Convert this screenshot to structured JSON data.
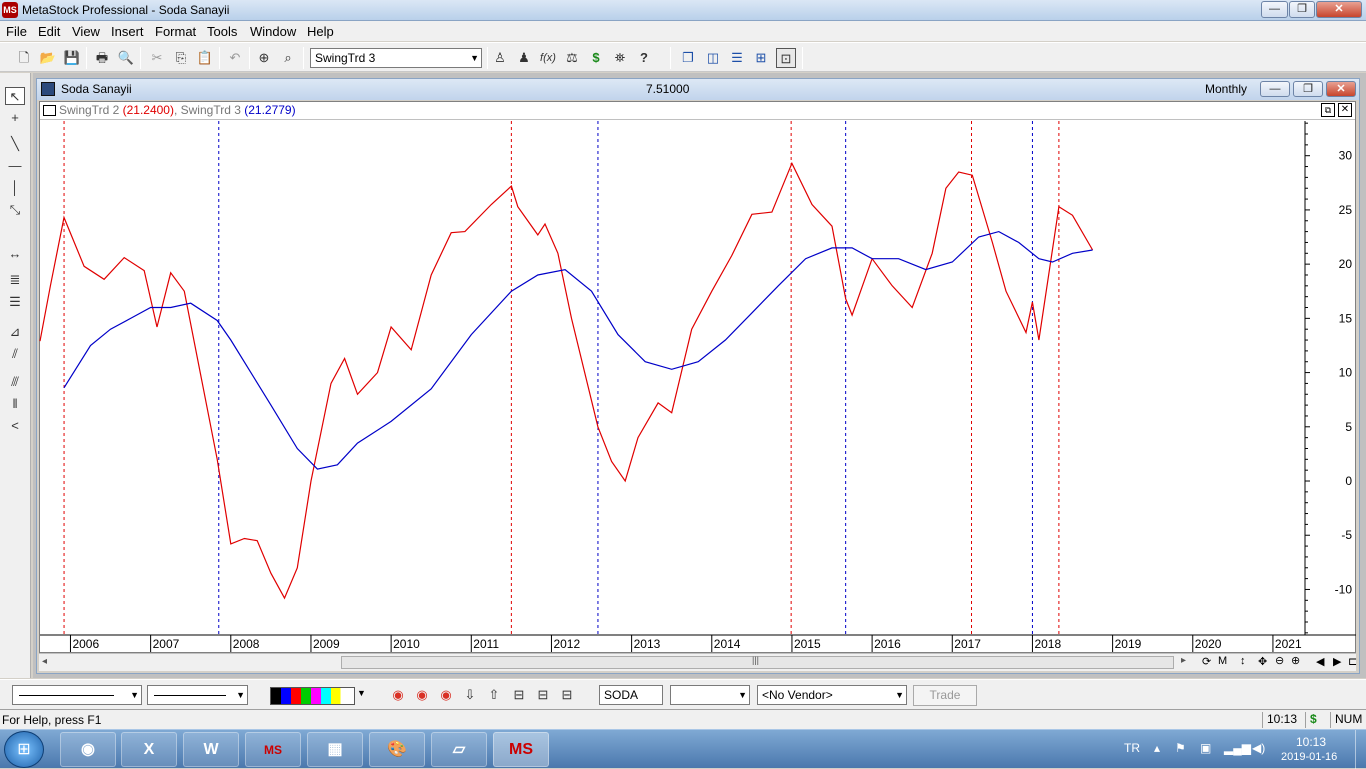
{
  "window": {
    "title": "MetaStock Professional - Soda Sanayii",
    "minimize": "—",
    "maximize": "❐",
    "close": "✕"
  },
  "menu": [
    "File",
    "Edit",
    "View",
    "Insert",
    "Format",
    "Tools",
    "Window",
    "Help"
  ],
  "toolbar": {
    "template_combo": "SwingTrd 3",
    "dollar": "$",
    "fx": "f(x)"
  },
  "chart_window": {
    "title": "Soda Sanayii",
    "price": "7.51000",
    "periodicity": "Monthly"
  },
  "legend": {
    "s1_name": "SwingTrd 2",
    "s1_value": "(21.2400)",
    "s2_name": "SwingTrd 3",
    "s2_value": "(21.2779)",
    "sep": ", "
  },
  "chart_data": {
    "type": "line",
    "x_range": [
      2005.62,
      2021.4
    ],
    "y_range": [
      -14.2,
      33.2
    ],
    "x_ticks": [
      2006,
      2007,
      2008,
      2009,
      2010,
      2011,
      2012,
      2013,
      2014,
      2015,
      2016,
      2017,
      2018,
      2019,
      2020,
      2021
    ],
    "x_tick_labels": [
      "2006",
      "2007",
      "2008",
      "2009",
      "2010",
      "2011",
      "2012",
      "2013",
      "2014",
      "2015",
      "2016",
      "2017",
      "2018",
      "2019",
      "2020",
      "2021"
    ],
    "y_ticks": [
      -10,
      -5,
      0,
      5,
      10,
      15,
      20,
      25,
      30
    ],
    "y_tick_labels": [
      "-10",
      "-5",
      "0",
      "5",
      "10",
      "15",
      "20",
      "25",
      "30"
    ],
    "red_vlines": [
      2005.92,
      2011.5,
      2014.99,
      2017.24,
      2018.33
    ],
    "blue_vlines": [
      2007.85,
      2012.58,
      2015.67,
      2018.0
    ],
    "series": [
      {
        "color": "#e00000",
        "values": [
          [
            2005.62,
            12.9
          ],
          [
            2005.75,
            18
          ],
          [
            2005.92,
            24.3
          ],
          [
            2006.17,
            19.8
          ],
          [
            2006.42,
            18.6
          ],
          [
            2006.67,
            20.6
          ],
          [
            2006.92,
            19.4
          ],
          [
            2007.08,
            14.2
          ],
          [
            2007.25,
            19.2
          ],
          [
            2007.42,
            17.5
          ],
          [
            2007.83,
            2
          ],
          [
            2008.0,
            -5.8
          ],
          [
            2008.17,
            -5.3
          ],
          [
            2008.33,
            -5.5
          ],
          [
            2008.5,
            -8.5
          ],
          [
            2008.67,
            -10.8
          ],
          [
            2008.83,
            -8
          ],
          [
            2009.0,
            0
          ],
          [
            2009.25,
            9
          ],
          [
            2009.42,
            11.3
          ],
          [
            2009.58,
            8
          ],
          [
            2009.83,
            10
          ],
          [
            2010.0,
            14.2
          ],
          [
            2010.25,
            12.1
          ],
          [
            2010.5,
            19
          ],
          [
            2010.75,
            22.9
          ],
          [
            2010.92,
            23
          ],
          [
            2011.25,
            25.5
          ],
          [
            2011.5,
            27.2
          ],
          [
            2011.58,
            25.3
          ],
          [
            2011.83,
            22.7
          ],
          [
            2011.92,
            23.7
          ],
          [
            2012.08,
            21
          ],
          [
            2012.25,
            15
          ],
          [
            2012.58,
            5
          ],
          [
            2012.75,
            1.8
          ],
          [
            2012.92,
            0
          ],
          [
            2013.08,
            4
          ],
          [
            2013.33,
            7.2
          ],
          [
            2013.5,
            6.3
          ],
          [
            2013.75,
            14
          ],
          [
            2014.0,
            17.5
          ],
          [
            2014.25,
            20.8
          ],
          [
            2014.5,
            24.6
          ],
          [
            2014.75,
            24.8
          ],
          [
            2015.0,
            29.3
          ],
          [
            2015.25,
            25.5
          ],
          [
            2015.5,
            23.5
          ],
          [
            2015.67,
            16.8
          ],
          [
            2015.75,
            15.3
          ],
          [
            2016.0,
            20.5
          ],
          [
            2016.25,
            18
          ],
          [
            2016.5,
            16
          ],
          [
            2016.75,
            21
          ],
          [
            2016.92,
            27
          ],
          [
            2017.08,
            28.5
          ],
          [
            2017.25,
            28.2
          ],
          [
            2017.5,
            22
          ],
          [
            2017.67,
            17.5
          ],
          [
            2017.92,
            13.7
          ],
          [
            2018.0,
            16.5
          ],
          [
            2018.08,
            13
          ],
          [
            2018.33,
            25.3
          ],
          [
            2018.5,
            24.5
          ],
          [
            2018.75,
            21.3
          ]
        ]
      },
      {
        "color": "#0000c8",
        "values": [
          [
            2005.92,
            8.6
          ],
          [
            2006.25,
            12.5
          ],
          [
            2006.5,
            14
          ],
          [
            2006.75,
            15
          ],
          [
            2007.0,
            16
          ],
          [
            2007.25,
            16
          ],
          [
            2007.5,
            16.4
          ],
          [
            2007.83,
            14.8
          ],
          [
            2008.0,
            13
          ],
          [
            2008.5,
            7
          ],
          [
            2008.83,
            3
          ],
          [
            2009.08,
            1.1
          ],
          [
            2009.33,
            1.5
          ],
          [
            2009.58,
            3.5
          ],
          [
            2010.0,
            5.5
          ],
          [
            2010.5,
            8.5
          ],
          [
            2011.0,
            13.5
          ],
          [
            2011.5,
            17.5
          ],
          [
            2011.83,
            19
          ],
          [
            2012.17,
            19.5
          ],
          [
            2012.5,
            17.5
          ],
          [
            2012.83,
            13.5
          ],
          [
            2013.17,
            11
          ],
          [
            2013.5,
            10.3
          ],
          [
            2013.83,
            11
          ],
          [
            2014.17,
            13
          ],
          [
            2014.5,
            15.5
          ],
          [
            2014.83,
            18
          ],
          [
            2015.17,
            20.5
          ],
          [
            2015.5,
            21.5
          ],
          [
            2015.75,
            21.5
          ],
          [
            2016.0,
            20.5
          ],
          [
            2016.33,
            20.5
          ],
          [
            2016.67,
            19.5
          ],
          [
            2017.0,
            20.2
          ],
          [
            2017.33,
            22.5
          ],
          [
            2017.58,
            23
          ],
          [
            2017.83,
            22
          ],
          [
            2018.08,
            20.5
          ],
          [
            2018.25,
            20.2
          ],
          [
            2018.5,
            21
          ],
          [
            2018.75,
            21.3
          ]
        ]
      }
    ]
  },
  "bottombar": {
    "symbol": "SODA",
    "vendor": "<No Vendor>",
    "trade": "Trade"
  },
  "statusbar": {
    "help": "For Help, press F1",
    "time": "10:13",
    "dollar": "$",
    "num": "NUM"
  },
  "taskbar": {
    "lang": "TR",
    "clock_time": "10:13",
    "clock_date": "2019-01-16",
    "ms_label": "MS"
  }
}
